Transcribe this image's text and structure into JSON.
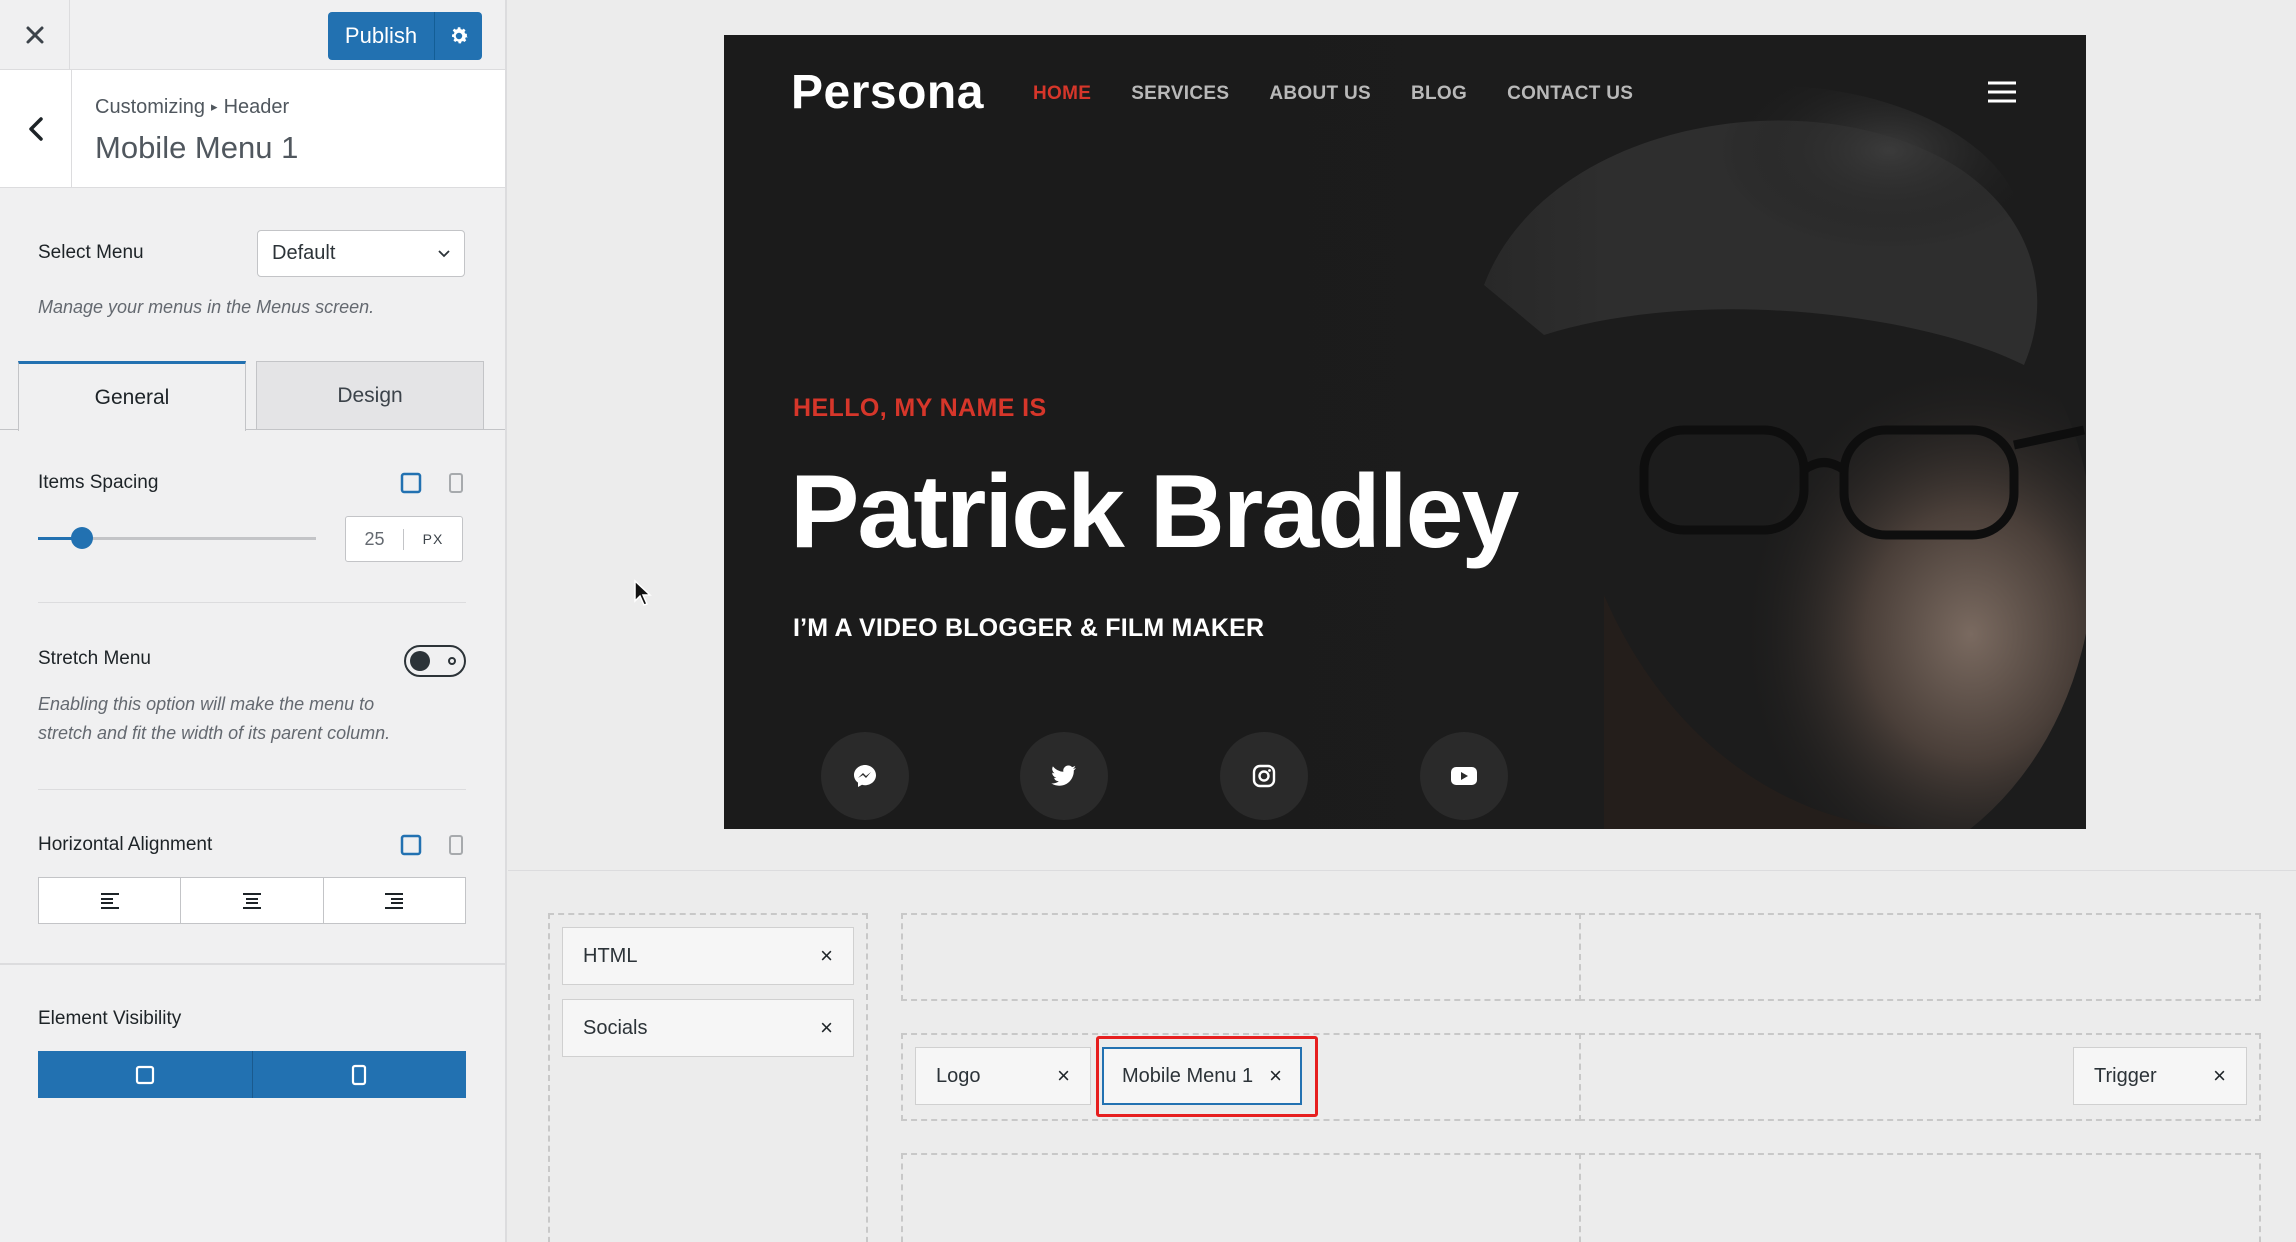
{
  "topbar": {
    "publish_label": "Publish"
  },
  "section": {
    "breadcrumb_parent": "Customizing",
    "breadcrumb_sep": "▸",
    "breadcrumb_current": "Header",
    "title": "Mobile Menu 1"
  },
  "select_menu": {
    "label": "Select Menu",
    "value": "Default",
    "hint": "Manage your menus in the Menus screen."
  },
  "tabs": [
    {
      "label": "General",
      "active": true
    },
    {
      "label": "Design",
      "active": false
    }
  ],
  "items_spacing": {
    "label": "Items Spacing",
    "value": "25",
    "unit": "PX",
    "slider_fraction": 0.16
  },
  "stretch_menu": {
    "label": "Stretch Menu",
    "enabled": false,
    "desc_line1": "Enabling this option will make the menu to",
    "desc_line2": "stretch and fit the width of its parent column."
  },
  "horizontal_alignment": {
    "label": "Horizontal Alignment"
  },
  "element_visibility": {
    "label": "Element Visibility"
  },
  "preview": {
    "logo": "Persona",
    "nav": [
      "HOME",
      "SERVICES",
      "ABOUT US",
      "BLOG",
      "CONTACT US"
    ],
    "kicker": "HELLO, MY NAME IS",
    "name": "Patrick Bradley",
    "subtitle": "I’M A VIDEO BLOGGER & FILM MAKER",
    "accent_color": "#d6362a",
    "socials": [
      "messenger-icon",
      "twitter-icon",
      "instagram-icon",
      "youtube-icon"
    ]
  },
  "builder": {
    "sidebar_chips": [
      "HTML",
      "Socials"
    ],
    "row_chips": {
      "logo": "Logo",
      "mobile_menu": "Mobile Menu 1",
      "trigger": "Trigger"
    },
    "close_glyph": "×"
  },
  "colors": {
    "primary": "#2271b1",
    "highlight": "#e61e1e"
  }
}
